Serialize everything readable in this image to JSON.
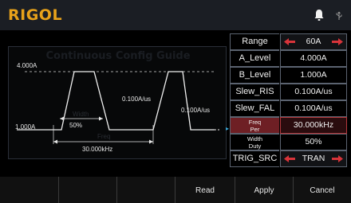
{
  "header": {
    "brand": "RIGOL"
  },
  "guide": {
    "title": "Continuous Config Guide",
    "labels": {
      "a_level": "4.000A",
      "b_level": "1.000A",
      "duty": "50%",
      "slew_rise": "0.100A/us",
      "slew_fall": "0.100A/us",
      "frequency": "30.000kHz",
      "faint_width": "Width",
      "faint_freq": "Freq"
    }
  },
  "params": [
    {
      "name": "Range",
      "value": "60A",
      "arrows": true
    },
    {
      "name": "A_Level",
      "value": "4.000A"
    },
    {
      "name": "B_Level",
      "value": "1.000A"
    },
    {
      "name": "Slew_RIS",
      "value": "0.100A/us"
    },
    {
      "name": "Slew_FAL",
      "value": "0.100A/us"
    },
    {
      "name_top": "Freq",
      "name_bottom": "Per",
      "value": "30.000kHz",
      "selected": true
    },
    {
      "name_top": "Width",
      "name_bottom": "Duty",
      "value": "50%"
    },
    {
      "name": "TRIG_SRC",
      "value": "TRAN",
      "arrows": true
    }
  ],
  "softkeys": [
    "",
    "",
    "",
    "Read",
    "Apply",
    "Cancel"
  ],
  "colors": {
    "brand": "#e8a21a",
    "accent_red": "#d8343a",
    "highlight": "#6e1f24",
    "marker": "#3aa7d8"
  }
}
